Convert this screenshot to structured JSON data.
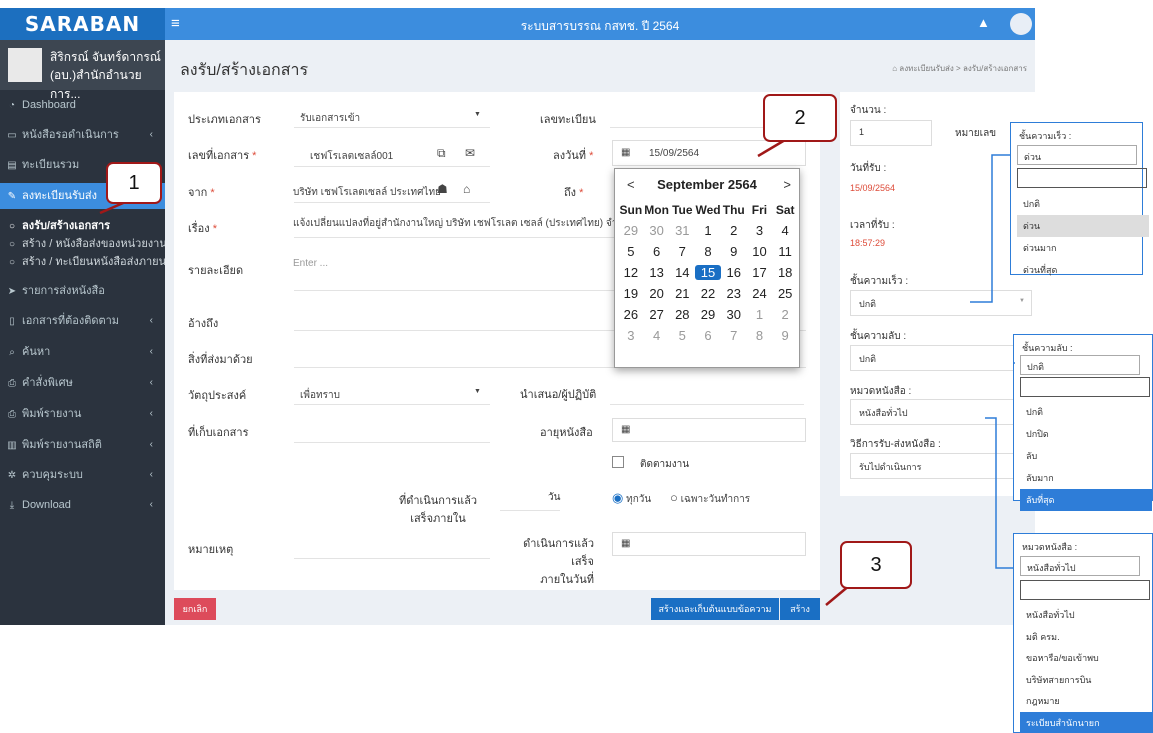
{
  "header": {
    "logo": "SARABAN",
    "title": "ระบบสารบรรณ กสทช. ปี 2564",
    "menu_icon": "hamburger-icon",
    "bell_icon": "bell-icon"
  },
  "user": {
    "name_line1": "สิริกรณ์ จันทร์ดากรณ์",
    "name_line2": "(อบ.)สำนักอำนวยการ..."
  },
  "sidebar": {
    "items": [
      {
        "label": "Dashboard",
        "icon": "dashboard-icon",
        "caret": false
      },
      {
        "label": "หนังสือรอดำเนินการ",
        "icon": "inbox-icon",
        "caret": true
      },
      {
        "label": "ทะเบียนรวม",
        "icon": "book-icon",
        "caret": false
      },
      {
        "label": "ลงทะเบียนรับส่ง",
        "icon": "edit-icon",
        "caret": false
      },
      {
        "label": "รายการส่งหนังสือ",
        "icon": "send-icon",
        "caret": false
      },
      {
        "label": "เอกสารที่ต้องติดตาม",
        "icon": "bookmark-icon",
        "caret": true
      },
      {
        "label": "ค้นหา",
        "icon": "search-icon",
        "caret": true
      },
      {
        "label": "คำสั่งพิเศษ",
        "icon": "print-icon",
        "caret": true
      },
      {
        "label": "พิมพ์รายงาน",
        "icon": "print-icon",
        "caret": true
      },
      {
        "label": "พิมพ์รายงานสถิติ",
        "icon": "bar-chart-icon",
        "caret": true
      },
      {
        "label": "ควบคุมระบบ",
        "icon": "gear-icon",
        "caret": true
      },
      {
        "label": "Download",
        "icon": "download-icon",
        "caret": true
      }
    ],
    "subitems": [
      "ลงรับ/สร้างเอกสาร",
      "สร้าง / หนังสือส่งของหน่วยงาน",
      "สร้าง / ทะเบียนหนังสือส่งภายนอก"
    ]
  },
  "page": {
    "title": "ลงรับ/สร้างเอกสาร",
    "breadcrumb_home": "ลงทะเบียนรับส่ง",
    "breadcrumb_sep": ">",
    "breadcrumb_current": "ลงรับ/สร้างเอกสาร"
  },
  "form": {
    "doc_type_label": "ประเภทเอกสาร",
    "doc_type_value": "รับเอกสารเข้า",
    "reg_no_label": "เลขทะเบียน",
    "doc_no_label": "เลขที่เอกสาร",
    "doc_no_value": "เชฟโรเลตเซลล์001",
    "date_label": "ลงวันที่",
    "date_value": "15/09/2564",
    "from_label": "จาก",
    "from_value": "บริษัท เชฟโรเลตเซลล์ ประเทศไทย",
    "to_label": "ถึง",
    "subject_label": "เรื่อง",
    "subject_value": "แจ้งเปลี่ยนแปลงที่อยู่สำนักงานใหญ่ บริษัท เชฟโรเลต เซลล์ (ประเทศไทย) จำกัด",
    "detail_label": "รายละเอียด",
    "detail_placeholder": "Enter ...",
    "ref_label": "อ้างถึง",
    "attach_label": "สิ่งที่ส่งมาด้วย",
    "purpose_label": "วัตถุประสงค์",
    "purpose_value": "เพื่อทราบ",
    "present_label": "นำเสนอ/ผู้ปฏิบัติ",
    "storage_label": "ที่เก็บเอกสาร",
    "age_label": "อายุหนังสือ",
    "follow_label": "ติดตามงาน",
    "done_within_line1": "ที่ดำเนินการแล้ว",
    "done_within_line2": "เสร็จภายใน",
    "day_label": "วัน",
    "radio_every": "ทุกวัน",
    "radio_work": "เฉพาะวันทำการ",
    "note_label": "หมายเหตุ",
    "done_date_line1": "ดำเนินการแล้วเสร็จ",
    "done_date_line2": "ภายในวันที่",
    "cancel": "ยกเลิก",
    "create_save": "สร้างและเก็บต้นแบบข้อความ",
    "create": "สร้าง"
  },
  "right": {
    "qty_label": "จำนวน :",
    "qty_value": "1",
    "note_no": "หมายเลข",
    "recv_date_label": "วันที่รับ :",
    "recv_date_value": "15/09/2564",
    "recv_time_label": "เวลาที่รับ :",
    "recv_time_value": "18:57:29",
    "speed_label": "ชั้นความเร็ว :",
    "speed_value": "ปกติ",
    "secret_label": "ชั้นความลับ :",
    "secret_value": "ปกติ",
    "category_label": "หมวดหนังสือ :",
    "category_value": "หนังสือทั่วไป",
    "method_label": "วิธีการรับ-ส่งหนังสือ :",
    "method_value": "รับไปดำเนินการ"
  },
  "calendar": {
    "month": "September 2564",
    "prev": "<",
    "next": ">",
    "dow": [
      "Sun",
      "Mon",
      "Tue",
      "Wed",
      "Thu",
      "Fri",
      "Sat"
    ],
    "weeks": [
      [
        "29",
        "30",
        "31",
        "1",
        "2",
        "3",
        "4"
      ],
      [
        "5",
        "6",
        "7",
        "8",
        "9",
        "10",
        "11"
      ],
      [
        "12",
        "13",
        "14",
        "15",
        "16",
        "17",
        "18"
      ],
      [
        "19",
        "20",
        "21",
        "22",
        "23",
        "24",
        "25"
      ],
      [
        "26",
        "27",
        "28",
        "29",
        "30",
        "1",
        "2"
      ],
      [
        "3",
        "4",
        "5",
        "6",
        "7",
        "8",
        "9"
      ]
    ],
    "selected": "15"
  },
  "popups": {
    "speed": {
      "title": "ชั้นความเร็ว :",
      "current": "ด่วน",
      "options": [
        "ปกติ",
        "ด่วน",
        "ด่วนมาก",
        "ด่วนที่สุด"
      ],
      "highlighted": "ด่วน"
    },
    "secret": {
      "title": "ชั้นความลับ :",
      "current": "ปกติ",
      "options": [
        "ปกติ",
        "ปกปิด",
        "ลับ",
        "ลับมาก",
        "ลับที่สุด"
      ],
      "highlighted": "ลับที่สุด"
    },
    "category": {
      "title": "หมวดหนังสือ :",
      "current": "หนังสือทั่วไป",
      "options": [
        "หนังสือทั่วไป",
        "มติ ครม.",
        "ขอหารือ/ขอเข้าพบ",
        "บริษัทสายการบิน",
        "กฎหมาย",
        "ระเบียบสำนักนายก"
      ],
      "highlighted": "ระเบียบสำนักนายก"
    }
  },
  "callouts": [
    "1",
    "2",
    "3"
  ],
  "colors": {
    "sidebar": "#2b333e",
    "topbar": "#3c8dde",
    "logo": "#1c6fbf",
    "accent": "#1a6fc4",
    "danger": "#dd4b39",
    "callout": "#a01818"
  }
}
